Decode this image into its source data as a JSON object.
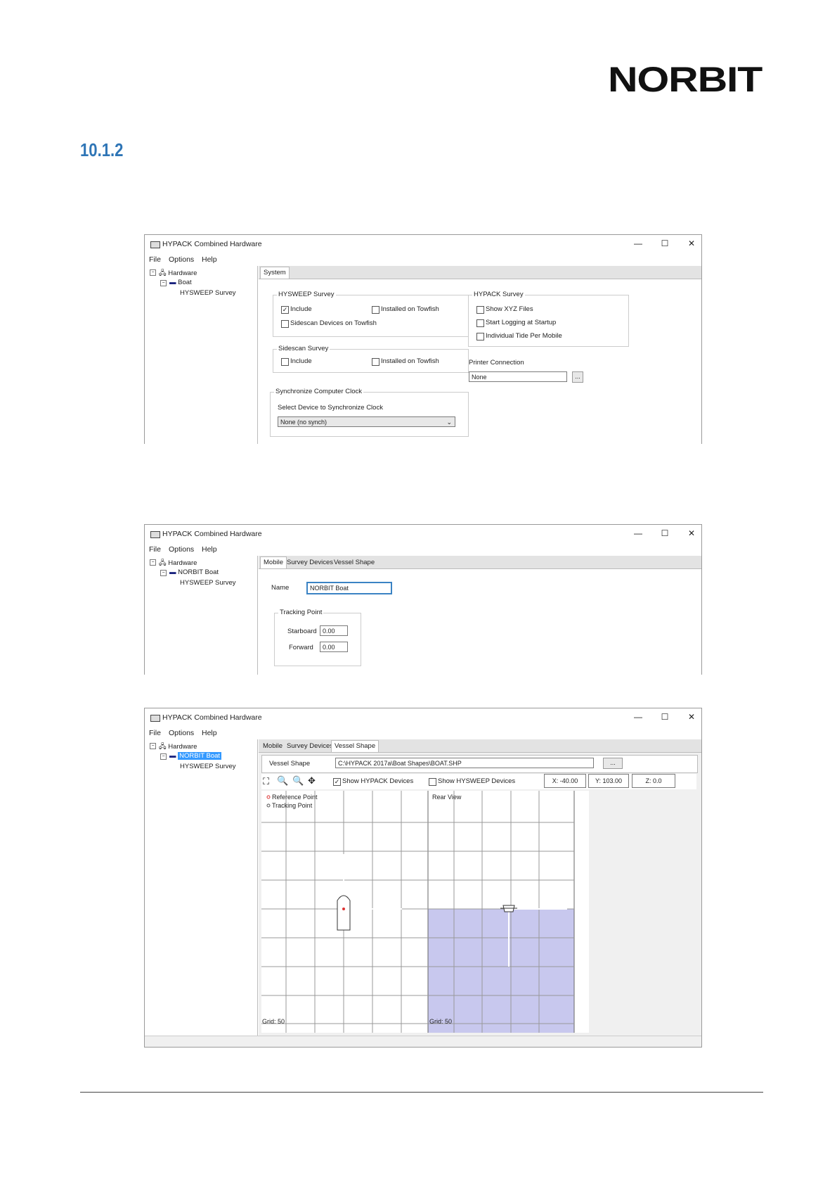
{
  "header": {
    "logo": "NORBIT",
    "section_number": "10.1.2"
  },
  "window1": {
    "title": "HYPACK Combined Hardware",
    "controls": {
      "minimize": "—",
      "maximize": "☐",
      "close": "✕"
    },
    "menu": [
      "File",
      "Options",
      "Help"
    ],
    "tree": {
      "root": "Hardware",
      "child": "Boat",
      "leaf": "HYSWEEP Survey"
    },
    "tab": "System",
    "hysweep": {
      "title": "HYSWEEP Survey",
      "include": "Include",
      "towfish": "Installed on Towfish",
      "sidescan": "Sidescan Devices on Towfish"
    },
    "sidescan": {
      "title": "Sidescan Survey",
      "include": "Include",
      "towfish": "Installed on Towfish"
    },
    "sync": {
      "title": "Synchronize Computer Clock",
      "label": "Select Device to Synchronize Clock",
      "value": "None (no synch)"
    },
    "hypack": {
      "title": "HYPACK Survey",
      "xyz": "Show XYZ Files",
      "logging": "Start Logging at Startup",
      "tide": "Individual Tide Per Mobile"
    },
    "printer": {
      "label": "Printer Connection",
      "value": "None",
      "browse": "..."
    }
  },
  "window2": {
    "title": "HYPACK Combined Hardware",
    "controls": {
      "minimize": "—",
      "maximize": "☐",
      "close": "✕"
    },
    "menu": [
      "File",
      "Options",
      "Help"
    ],
    "tree": {
      "root": "Hardware",
      "child": "NORBIT Boat",
      "leaf": "HYSWEEP Survey"
    },
    "tabs": [
      "Mobile",
      "Survey Devices",
      "Vessel Shape"
    ],
    "name_label": "Name",
    "name_value": "NORBIT Boat",
    "tracking": {
      "title": "Tracking Point",
      "starboard_label": "Starboard",
      "starboard": "0.00",
      "forward_label": "Forward",
      "forward": "0.00"
    }
  },
  "window3": {
    "title": "HYPACK Combined Hardware",
    "controls": {
      "minimize": "—",
      "maximize": "☐",
      "close": "✕"
    },
    "menu": [
      "File",
      "Options",
      "Help"
    ],
    "tree": {
      "root": "Hardware",
      "child": "NORBIT Boat",
      "leaf": "HYSWEEP Survey"
    },
    "tabs": [
      "Mobile",
      "Survey Devices",
      "Vessel Shape"
    ],
    "vessel_shape_label": "Vessel Shape",
    "vessel_shape_path": "C:\\HYPACK 2017a\\Boat Shapes\\BOAT.SHP",
    "browse": "...",
    "show_hypack": "Show HYPACK Devices",
    "show_hysweep": "Show HYSWEEP Devices",
    "coord_x": "X: -40.00",
    "coord_y": "Y: 103.00",
    "coord_z": "Z: 0.0",
    "legend_ref": "Reference Point",
    "legend_track": "Tracking Point",
    "rear_view": "Rear View",
    "grid_left": "Grid: 50",
    "grid_right": "Grid: 50",
    "colors": {
      "water": "#c8c8ee",
      "selection": "#3399ff"
    }
  }
}
